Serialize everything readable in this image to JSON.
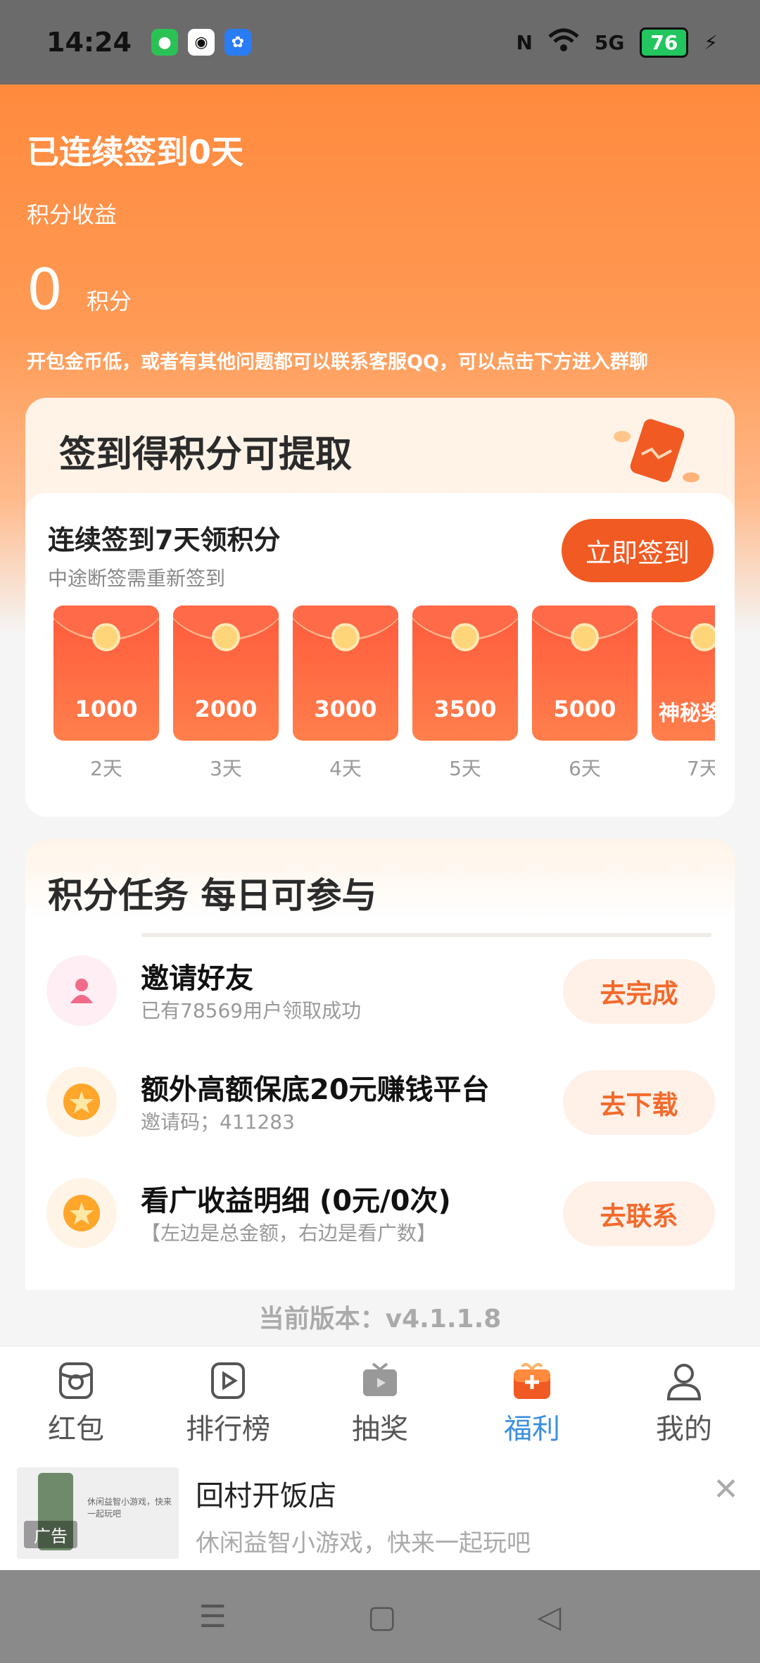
{
  "status_bar": {
    "time": "14:24",
    "signal": "5G",
    "battery": "76"
  },
  "header": {
    "title": "已连续签到0天",
    "subtitle": "积分收益",
    "points_value": "0",
    "points_unit": "积分",
    "notice": "开包金币低，或者有其他问题都可以联系客服QQ，可以点击下方进入群聊"
  },
  "sign_card": {
    "title": "签到得积分可提取",
    "heading": "连续签到7天领积分",
    "hint": "中途断签需重新签到",
    "button": "立即签到",
    "rewards": [
      {
        "amount": "1000",
        "day": "2天"
      },
      {
        "amount": "2000",
        "day": "3天"
      },
      {
        "amount": "3000",
        "day": "4天"
      },
      {
        "amount": "3500",
        "day": "5天"
      },
      {
        "amount": "5000",
        "day": "6天"
      },
      {
        "amount": "神秘奖",
        "day": "7天"
      }
    ]
  },
  "task_card": {
    "title": "积分任务  每日可参与",
    "tasks": [
      {
        "name": "邀请好友",
        "desc": "已有78569用户领取成功",
        "button": "去完成"
      },
      {
        "name": "额外高额保底20元赚钱平台",
        "desc": "邀请码；411283",
        "button": "去下载"
      },
      {
        "name": "看广收益明细  (0元/0次)",
        "desc": "【左边是总金额，右边是看广数】",
        "button": "去联系"
      }
    ]
  },
  "version": "当前版本：v4.1.1.8",
  "tabs": [
    {
      "label": "红包",
      "icon": "red-packet-icon"
    },
    {
      "label": "排行榜",
      "icon": "ranking-icon"
    },
    {
      "label": "抽奖",
      "icon": "lottery-icon"
    },
    {
      "label": "福利",
      "icon": "welfare-icon",
      "active": true
    },
    {
      "label": "我的",
      "icon": "profile-icon"
    }
  ],
  "ad": {
    "name": "回村开饭店",
    "desc": "休闲益智小游戏，快来一起玩吧",
    "badge": "广告",
    "thumb_text": "休闲益智小游戏，快来一起玩吧"
  },
  "colors": {
    "accent": "#f15a22",
    "tab_active": "#3b8fe0"
  }
}
